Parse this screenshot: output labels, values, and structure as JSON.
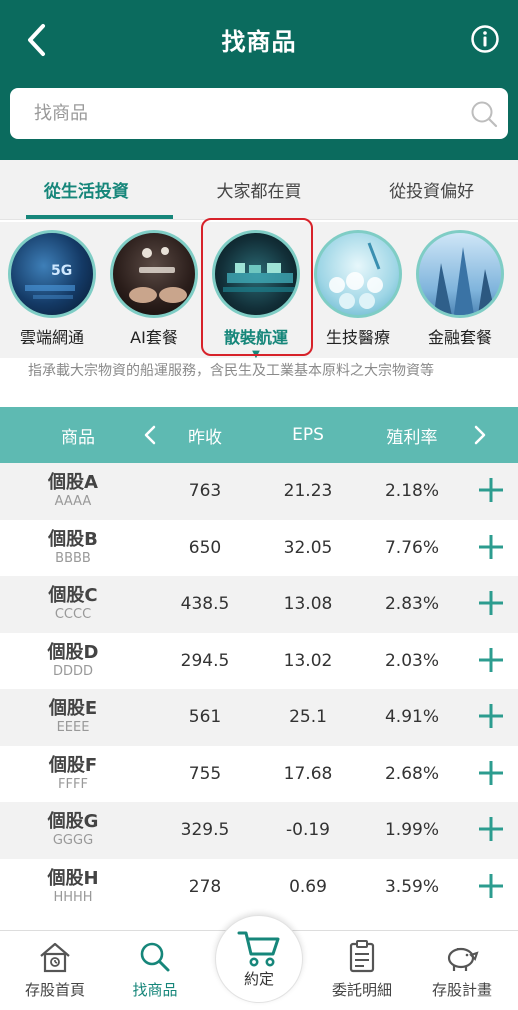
{
  "header": {
    "title": "找商品"
  },
  "search": {
    "placeholder": "找商品"
  },
  "tabs": [
    {
      "label": "從生活投資",
      "active": true
    },
    {
      "label": "大家都在買",
      "active": false
    },
    {
      "label": "從投資偏好",
      "active": false
    }
  ],
  "categories": [
    {
      "label": "雲端網通",
      "icon": "cloud-5g-image"
    },
    {
      "label": "AI套餐",
      "icon": "ai-chat-image"
    },
    {
      "label": "散裝航運",
      "icon": "shipping-image",
      "selected": true
    },
    {
      "label": "生技醫療",
      "icon": "biotech-image"
    },
    {
      "label": "金融套餐",
      "icon": "finance-buildings-image"
    }
  ],
  "category_description": "指承載大宗物資的船運服務，含民生及工業基本原料之大宗物資等",
  "table": {
    "headers": {
      "product": "商品",
      "prev_close": "昨收",
      "eps": "EPS",
      "yield": "殖利率"
    },
    "rows": [
      {
        "name": "個股A",
        "code": "AAAA",
        "prev_close": "763",
        "eps": "21.23",
        "yield": "2.18%"
      },
      {
        "name": "個股B",
        "code": "BBBB",
        "prev_close": "650",
        "eps": "32.05",
        "yield": "7.76%"
      },
      {
        "name": "個股C",
        "code": "CCCC",
        "prev_close": "438.5",
        "eps": "13.08",
        "yield": "2.83%"
      },
      {
        "name": "個股D",
        "code": "DDDD",
        "prev_close": "294.5",
        "eps": "13.02",
        "yield": "2.03%"
      },
      {
        "name": "個股E",
        "code": "EEEE",
        "prev_close": "561",
        "eps": "25.1",
        "yield": "4.91%"
      },
      {
        "name": "個股F",
        "code": "FFFF",
        "prev_close": "755",
        "eps": "17.68",
        "yield": "2.68%"
      },
      {
        "name": "個股G",
        "code": "GGGG",
        "prev_close": "329.5",
        "eps": "-0.19",
        "yield": "1.99%"
      },
      {
        "name": "個股H",
        "code": "HHHH",
        "prev_close": "278",
        "eps": "0.69",
        "yield": "3.59%"
      }
    ]
  },
  "bottom_nav": [
    {
      "label": "存股首頁",
      "icon": "home-icon"
    },
    {
      "label": "找商品",
      "icon": "search-icon",
      "active": true
    },
    {
      "label": "約定",
      "icon": "cart-icon"
    },
    {
      "label": "委託明細",
      "icon": "clipboard-icon"
    },
    {
      "label": "存股計畫",
      "icon": "piggy-bank-icon"
    }
  ],
  "colors": {
    "brand": "#0b6b5e",
    "accent": "#16867a",
    "table_header": "#5ebab2",
    "highlight": "#d7222a"
  }
}
